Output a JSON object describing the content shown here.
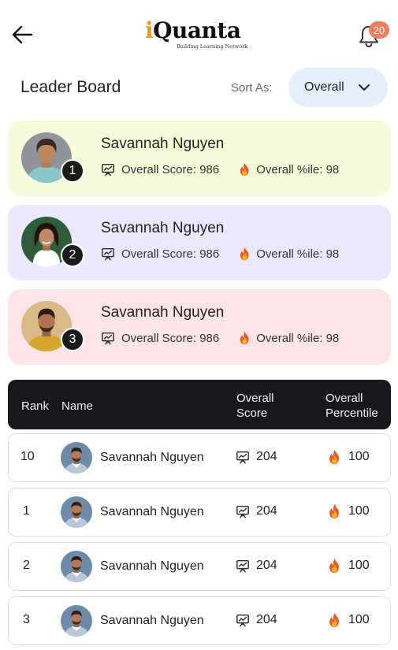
{
  "header": {
    "logo_main": "Quanta",
    "logo_i": "i",
    "logo_tagline": "Building Learning Network",
    "notification_count": "20"
  },
  "title": "Leader Board",
  "sort": {
    "label": "Sort As:",
    "value": "Overall"
  },
  "top_cards": [
    {
      "rank": "1",
      "name": "Savannah Nguyen",
      "score_label": "Overall Score: 986",
      "pct_label": "Overall %ile: 98",
      "bg": "#f6fad8"
    },
    {
      "rank": "2",
      "name": "Savannah Nguyen",
      "score_label": "Overall Score: 986",
      "pct_label": "Overall %ile: 98",
      "bg": "#ebe8fc"
    },
    {
      "rank": "3",
      "name": "Savannah Nguyen",
      "score_label": "Overall Score: 986",
      "pct_label": "Overall %ile: 98",
      "bg": "#fde4e6"
    }
  ],
  "table": {
    "headers": {
      "rank": "Rank",
      "name": "Name",
      "score_line1": "Overall",
      "score_line2": "Score",
      "pct_line1": "Overall",
      "pct_line2": "Percentile"
    },
    "rows": [
      {
        "rank": "10",
        "name": "Savannah Nguyen",
        "score": "204",
        "percentile": "100"
      },
      {
        "rank": "1",
        "name": "Savannah Nguyen",
        "score": "204",
        "percentile": "100"
      },
      {
        "rank": "2",
        "name": "Savannah Nguyen",
        "score": "204",
        "percentile": "100"
      },
      {
        "rank": "3",
        "name": "Savannah Nguyen",
        "score": "204",
        "percentile": "100"
      }
    ]
  },
  "colors": {
    "brand_orange": "#f39a12",
    "badge": "#ef7e5d",
    "table_header": "#17181c",
    "sort_bg": "#e5eefb"
  }
}
